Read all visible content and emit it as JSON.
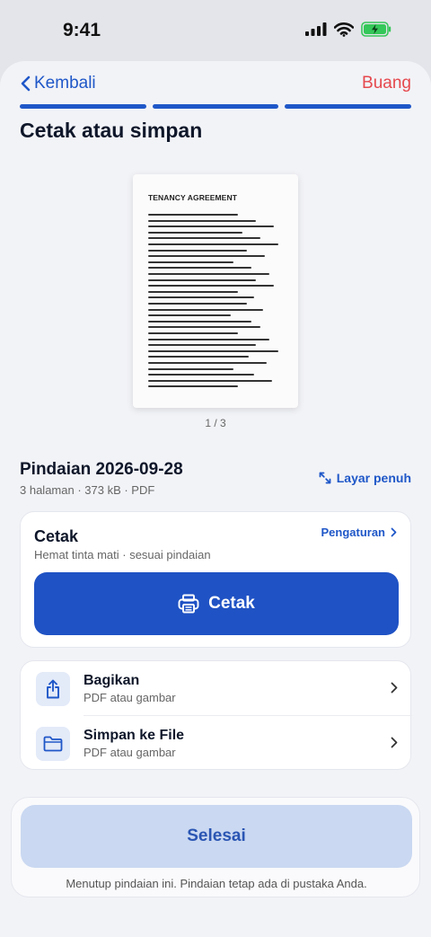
{
  "status_bar": {
    "time": "9:41"
  },
  "nav": {
    "back_label": "Kembali",
    "discard_label": "Buang",
    "progress_steps": 3,
    "progress_completed": 3
  },
  "page": {
    "title": "Cetak atau simpan"
  },
  "preview": {
    "document_heading": "TENANCY AGREEMENT",
    "page_counter": "1 / 3"
  },
  "scan": {
    "name": "Pindaian 2026-09-28",
    "meta": "3 halaman · 373 kB · PDF",
    "fullscreen_label": "Layar penuh"
  },
  "print_card": {
    "title": "Cetak",
    "subtitle": "Hemat tinta mati · sesuai pindaian",
    "settings_label": "Pengaturan",
    "button_label": "Cetak"
  },
  "actions": [
    {
      "title": "Bagikan",
      "subtitle": "PDF atau gambar",
      "icon": "share-icon"
    },
    {
      "title": "Simpan ke File",
      "subtitle": "PDF atau gambar",
      "icon": "folder-icon"
    }
  ],
  "footer": {
    "done_label": "Selesai",
    "note": "Menutup pindaian ini. Pindaian tetap ada di pustaka Anda."
  },
  "colors": {
    "accent": "#1f57c8",
    "discard": "#e5484d",
    "primary_button": "#1f52c4",
    "done_button": "#cad8f1"
  }
}
